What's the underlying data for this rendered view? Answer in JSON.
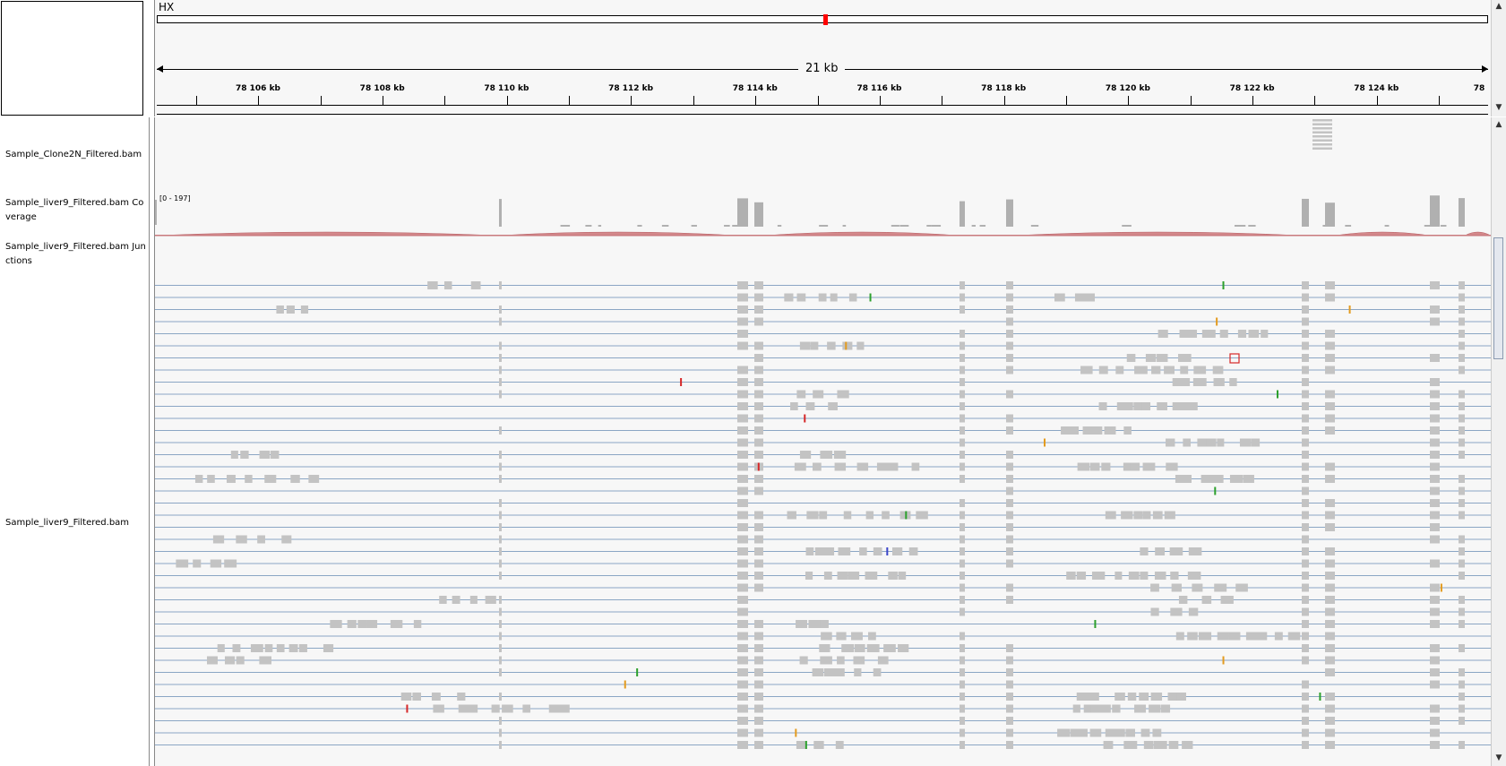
{
  "locus": {
    "chromosome": "HX",
    "span_label": "21 kb",
    "tick_labels": [
      "78 106 kb",
      "78 108 kb",
      "78 110 kb",
      "78 112 kb",
      "78 114 kb",
      "78 116 kb",
      "78 118 kb",
      "78 120 kb",
      "78 122 kb",
      "78 124 kb",
      "78"
    ]
  },
  "tracks": {
    "bam1": "Sample_Clone2N_Filtered.bam",
    "coverage": "Sample_liver9_Filtered.bam Coverage",
    "coverage_range": "[0 - 197]",
    "junctions": "Sample_liver9_Filtered.bam Junctions",
    "alignments": "Sample_liver9_Filtered.bam"
  },
  "colors": {
    "panel_bg": "#f7f7f7",
    "read": "#c3c3c3",
    "split_line": "#8ba6c4",
    "coverage": "#b0b0b0",
    "junction": "#d4888b",
    "ideogram_marker": "#ff0000",
    "mismatch_colors": [
      "#2ca02c",
      "#d62728",
      "#e39b1f",
      "#3a45c9"
    ]
  },
  "icons": {
    "scroll_up": "arrow-up-icon",
    "scroll_down": "arrow-down-icon"
  }
}
